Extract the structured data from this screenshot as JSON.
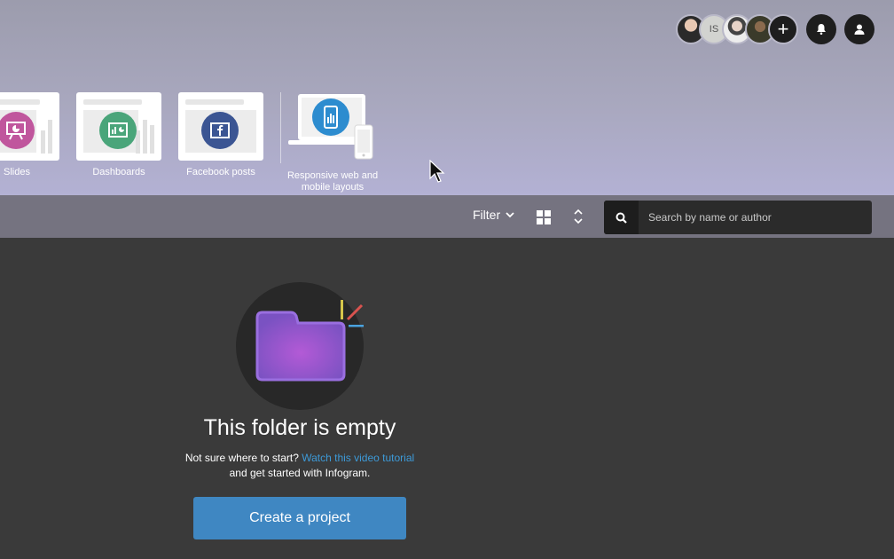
{
  "header": {
    "collaborators": [
      {
        "name": "avatar-1",
        "initials": ""
      },
      {
        "name": "avatar-2",
        "initials": "IS"
      },
      {
        "name": "avatar-3",
        "initials": ""
      },
      {
        "name": "avatar-4",
        "initials": ""
      }
    ],
    "add_icon": "plus-icon",
    "notifications_icon": "bell-icon",
    "profile_icon": "user-icon"
  },
  "templates": [
    {
      "label": "Slides",
      "icon": "presentation-icon",
      "color": "#c0569d"
    },
    {
      "label": "Dashboards",
      "icon": "dashboard-icon",
      "color": "#4aa57a"
    },
    {
      "label": "Facebook posts",
      "icon": "facebook-icon",
      "color": "#3b5593"
    },
    {
      "label": "Responsive web and mobile layouts",
      "icon": "phone-icon",
      "color": "#2d8ccf"
    }
  ],
  "toolbar": {
    "filter_label": "Filter",
    "search_placeholder": "Search by name or author"
  },
  "empty_state": {
    "title": "This folder is empty",
    "text_before_link": "Not sure where to start?",
    "link_text": "Watch this video tutorial",
    "text_after_link": "and get started with Infogram.",
    "button_label": "Create a project"
  },
  "colors": {
    "accent_blue": "#3f87c2",
    "link_blue": "#3d9ad8",
    "folder_purple": "#8a55c8"
  }
}
